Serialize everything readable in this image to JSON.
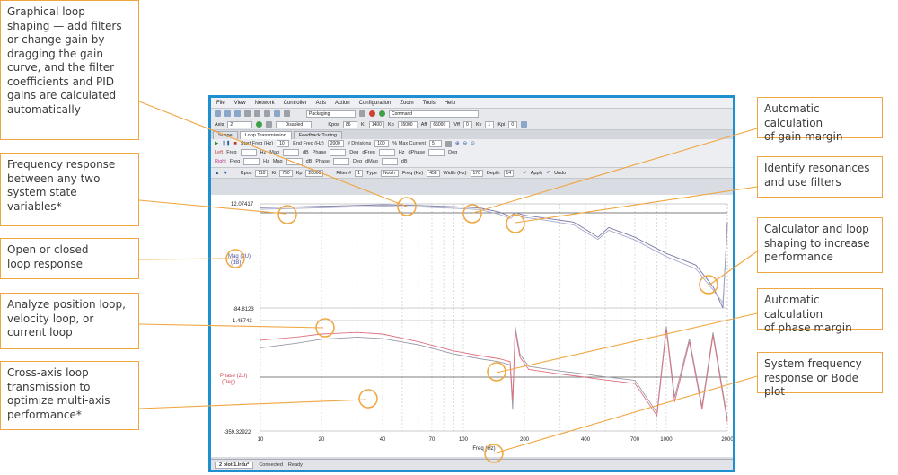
{
  "callouts": {
    "loop_shaping": "Graphical loop\nshaping — add filters\nor change gain by\ndragging the gain\ncurve, and the filter\ncoefficients and PID\ngains are calculated\nautomatically",
    "freq_response": "Frequency response\nbetween any two\nsystem state\nvariables*",
    "open_closed": "Open or closed\nloop response",
    "analyze_loop": "Analyze position loop,\nvelocity loop, or\ncurrent loop",
    "cross_axis": "Cross-axis loop\ntransmission to\noptimize multi-axis\nperformance*",
    "gain_margin": "Automatic calculation\nof gain margin",
    "resonances": "Identify resonances\nand use filters",
    "calculator": "Calculator and loop\nshaping to increase\nperformance",
    "phase_margin": "Automatic calculation\nof phase margin",
    "bode": "System frequency\nresponse or Bode plot"
  },
  "menu": [
    "File",
    "View",
    "Network",
    "Controller",
    "Axis",
    "Action",
    "Configuration",
    "Zoom",
    "Tools",
    "Help"
  ],
  "toolbar": {
    "packaging": "Packaging",
    "command": "Command",
    "axis_label": "Axis",
    "axis_value": "2",
    "disabled": "Disabled",
    "kpp_label": "Kpos",
    "kpp_value": "86",
    "ki_label": "Ki",
    "ki_value": "1400",
    "kp_label": "Kp",
    "kp_value": "65000",
    "aff_label": "Aff",
    "aff_value": "65000",
    "vff_label": "Vff",
    "vff_value": "0",
    "kv_label": "Kv",
    "kv_value": "1",
    "kpi_label": "Kpi",
    "kpi_value": "0"
  },
  "tabs": [
    "Scope",
    "Loop Transmission",
    "Feedback Tuning"
  ],
  "params": {
    "start_freq_label": "Start Freq (Hz)",
    "start_freq": "10",
    "end_freq_label": "End Freq (Hz)",
    "end_freq": "2000",
    "divisions_label": "# Divisions",
    "divisions": "100",
    "max_current_label": "% Max Current",
    "max_current": "5",
    "left": "Left",
    "right": "Right",
    "freq": "Freq",
    "hz": "Hz",
    "db": "dB",
    "mag": "Mag",
    "phase": "Phase",
    "deg": "Deg",
    "dfreq": "dFreq",
    "dmag": "dMag",
    "dphase": "dPhase"
  },
  "filter": {
    "kpos_label": "Kpos",
    "kpos": "110",
    "ki_label": "Ki",
    "ki": "750",
    "kp_label": "Kp",
    "kp": "20000",
    "filter_label": "Filter #",
    "filter_no": "1",
    "type_label": "Type",
    "type": "Notch",
    "freq_label": "Freq (Hz)",
    "freq": "458",
    "width_label": "Width (Hz)",
    "width": "170",
    "depth_label": "Depth",
    "depth": "14",
    "apply": "Apply",
    "undo": "Undo"
  },
  "plot": {
    "mag_max": "12.07417",
    "mag_min": "-84.8123",
    "mag_label_1": "Mag (2U)",
    "mag_label_2": "(dB)",
    "phase_max": "-1.45743",
    "phase_min": "-359.32922",
    "phase_label_1": "Phase (2U)",
    "phase_label_2": "(Deg)",
    "xlabel": "Freq (Hz)",
    "x_ticks": [
      "10",
      "20",
      "40",
      "70",
      "100",
      "200",
      "400",
      "700",
      "1000",
      "2000"
    ]
  },
  "status": {
    "plot_tab": "2 plot 1.lrdu*",
    "connected": "Connected",
    "ready": "Ready"
  },
  "chart_data": {
    "type": "line",
    "xlabel": "Freq (Hz)",
    "xscale": "log",
    "xlim": [
      10,
      2000
    ],
    "x_ticks": [
      10,
      20,
      40,
      70,
      100,
      200,
      400,
      700,
      1000,
      2000
    ],
    "series": [
      {
        "x": [
          10,
          15,
          20,
          30,
          40,
          60,
          90,
          120,
          150,
          170,
          180,
          200,
          260,
          350,
          420,
          460,
          520,
          700,
          1000,
          1400,
          1700,
          1900,
          2000
        ],
        "values": [
          8.5,
          9.2,
          9.8,
          10.6,
          11.2,
          10.6,
          9.4,
          8.3,
          4.5,
          0.5,
          4.0,
          1.5,
          -1.5,
          -5.0,
          -14.0,
          -19.0,
          -10.0,
          -19.0,
          -34.0,
          -45.0,
          -65.0,
          -84.8,
          -5.0
        ]
      },
      {
        "x": [
          10,
          15,
          20,
          30,
          40,
          60,
          90,
          120,
          150,
          170,
          180,
          200,
          260,
          350,
          420,
          460,
          520,
          700,
          1000,
          1400,
          1700,
          1900,
          2000
        ],
        "values": [
          7.0,
          7.8,
          8.4,
          9.3,
          9.9,
          9.2,
          8.0,
          6.8,
          2.5,
          -1.5,
          2.0,
          -0.5,
          -3.5,
          -7.5,
          -16.5,
          -21.0,
          -12.5,
          -21.5,
          -37.0,
          -48.5,
          -68.0,
          -80.0,
          -10.0
        ]
      },
      {
        "x": [
          10,
          15,
          20,
          30,
          40,
          60,
          90,
          120,
          150,
          170,
          175,
          180,
          190,
          210,
          300,
          400,
          450,
          700,
          900,
          1000,
          1100,
          1300,
          1500,
          1700,
          2000
        ],
        "values": [
          -90,
          -75,
          -62,
          -55,
          -60,
          -80,
          -110,
          -125,
          -135,
          -145,
          -290,
          -20,
          -110,
          -150,
          -165,
          -175,
          -180,
          -195,
          -300,
          -20,
          -250,
          -60,
          -280,
          -40,
          -320
        ]
      },
      {
        "x": [
          10,
          15,
          20,
          30,
          40,
          60,
          90,
          120,
          150,
          170,
          175,
          180,
          190,
          210,
          300,
          400,
          450,
          700,
          900,
          1000,
          1100,
          1300,
          1500,
          1700,
          2000
        ],
        "values": [
          -65,
          -55,
          -45,
          -40,
          -45,
          -70,
          -100,
          -115,
          -125,
          -135,
          -260,
          -35,
          -120,
          -160,
          -175,
          -185,
          -190,
          -205,
          -310,
          -30,
          -265,
          -70,
          -290,
          -50,
          -330
        ]
      }
    ]
  }
}
